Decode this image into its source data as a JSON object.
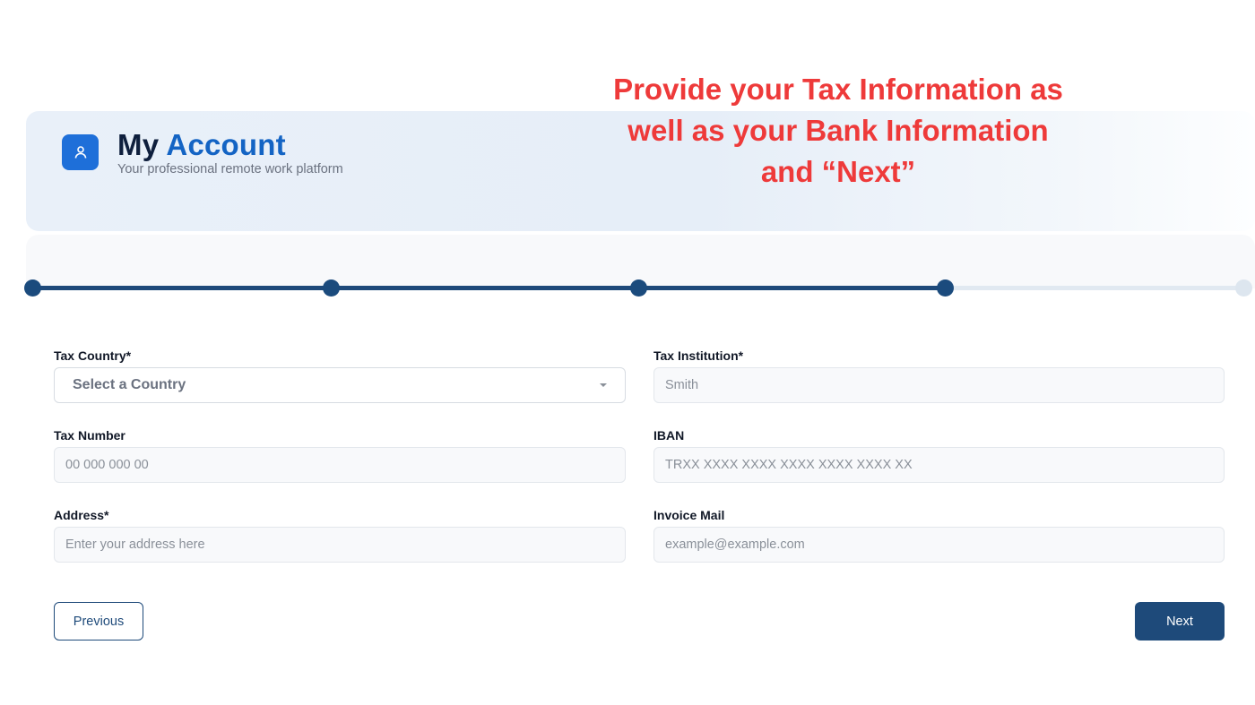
{
  "annotation": {
    "lines": [
      "Provide your Tax Information as",
      "well as your Bank Information",
      "and “Next”"
    ]
  },
  "header": {
    "icon": "user-icon",
    "title_word1": "My",
    "title_word2": "Account",
    "subtitle": "Your professional remote work platform"
  },
  "stepper": {
    "total_steps": 5,
    "current_step": 4
  },
  "form": {
    "tax_country": {
      "label": "Tax Country*",
      "selected": "Select a Country"
    },
    "tax_institution": {
      "label": "Tax Institution*",
      "placeholder": "Smith"
    },
    "tax_number": {
      "label": "Tax Number",
      "placeholder": "00 000 000 00"
    },
    "iban": {
      "label": "IBAN",
      "placeholder": "TRXX XXXX XXXX XXXX XXXX XXXX XX"
    },
    "address": {
      "label": "Address*",
      "placeholder": "Enter your address here"
    },
    "invoice_mail": {
      "label": "Invoice Mail",
      "placeholder": "example@example.com"
    }
  },
  "actions": {
    "previous_label": "Previous",
    "next_label": "Next"
  },
  "colors": {
    "accent": "#1e4a7a",
    "brand_blue": "#1464c4",
    "annotation_red": "#ee3a3a"
  }
}
